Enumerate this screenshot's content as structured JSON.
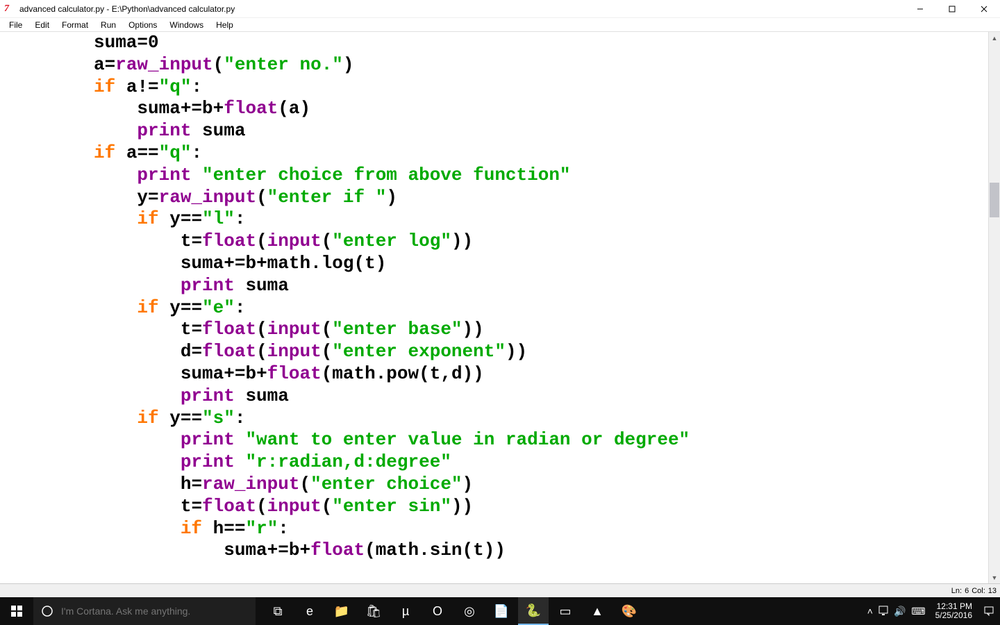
{
  "window": {
    "app_icon_text": "7",
    "title": "advanced calculator.py - E:\\Python\\advanced calculator.py"
  },
  "menubar": {
    "items": [
      "File",
      "Edit",
      "Format",
      "Run",
      "Options",
      "Windows",
      "Help"
    ]
  },
  "code": {
    "tokens": [
      [
        [
          "nm",
          "suma"
        ],
        [
          "op",
          "="
        ],
        [
          "num",
          "0"
        ]
      ],
      [
        [
          "nm",
          "a"
        ],
        [
          "op",
          "="
        ],
        [
          "bi",
          "raw_input"
        ],
        [
          "op",
          "("
        ],
        [
          "str",
          "\"enter no.\""
        ],
        [
          "op",
          ")"
        ]
      ],
      [
        [
          "kw",
          "if"
        ],
        [
          "nm",
          " a"
        ],
        [
          "op",
          "!="
        ],
        [
          "str",
          "\"q\""
        ],
        [
          "op",
          ":"
        ]
      ],
      [
        [
          "nm",
          "    suma"
        ],
        [
          "op",
          "+="
        ],
        [
          "nm",
          "b"
        ],
        [
          "op",
          "+"
        ],
        [
          "bi",
          "float"
        ],
        [
          "op",
          "("
        ],
        [
          "nm",
          "a"
        ],
        [
          "op",
          ")"
        ]
      ],
      [
        [
          "nm",
          "    "
        ],
        [
          "bi",
          "print"
        ],
        [
          "nm",
          " suma"
        ]
      ],
      [
        [
          "kw",
          "if"
        ],
        [
          "nm",
          " a"
        ],
        [
          "op",
          "=="
        ],
        [
          "str",
          "\"q\""
        ],
        [
          "op",
          ":"
        ]
      ],
      [
        [
          "nm",
          "    "
        ],
        [
          "bi",
          "print"
        ],
        [
          "nm",
          " "
        ],
        [
          "str",
          "\"enter choice from above function\""
        ]
      ],
      [
        [
          "nm",
          "    y"
        ],
        [
          "op",
          "="
        ],
        [
          "bi",
          "raw_input"
        ],
        [
          "op",
          "("
        ],
        [
          "str",
          "\"enter if \""
        ],
        [
          "op",
          ")"
        ]
      ],
      [
        [
          "nm",
          "    "
        ],
        [
          "kw",
          "if"
        ],
        [
          "nm",
          " y"
        ],
        [
          "op",
          "=="
        ],
        [
          "str",
          "\"l\""
        ],
        [
          "op",
          ":"
        ]
      ],
      [
        [
          "nm",
          "        t"
        ],
        [
          "op",
          "="
        ],
        [
          "bi",
          "float"
        ],
        [
          "op",
          "("
        ],
        [
          "bi",
          "input"
        ],
        [
          "op",
          "("
        ],
        [
          "str",
          "\"enter log\""
        ],
        [
          "op",
          "))"
        ]
      ],
      [
        [
          "nm",
          "        suma"
        ],
        [
          "op",
          "+="
        ],
        [
          "nm",
          "b"
        ],
        [
          "op",
          "+"
        ],
        [
          "nm",
          "math.log"
        ],
        [
          "op",
          "("
        ],
        [
          "nm",
          "t"
        ],
        [
          "op",
          ")"
        ]
      ],
      [
        [
          "nm",
          "        "
        ],
        [
          "bi",
          "print"
        ],
        [
          "nm",
          " suma"
        ]
      ],
      [
        [
          "nm",
          "    "
        ],
        [
          "kw",
          "if"
        ],
        [
          "nm",
          " y"
        ],
        [
          "op",
          "=="
        ],
        [
          "str",
          "\"e\""
        ],
        [
          "op",
          ":"
        ]
      ],
      [
        [
          "nm",
          "        t"
        ],
        [
          "op",
          "="
        ],
        [
          "bi",
          "float"
        ],
        [
          "op",
          "("
        ],
        [
          "bi",
          "input"
        ],
        [
          "op",
          "("
        ],
        [
          "str",
          "\"enter base\""
        ],
        [
          "op",
          "))"
        ]
      ],
      [
        [
          "nm",
          "        d"
        ],
        [
          "op",
          "="
        ],
        [
          "bi",
          "float"
        ],
        [
          "op",
          "("
        ],
        [
          "bi",
          "input"
        ],
        [
          "op",
          "("
        ],
        [
          "str",
          "\"enter exponent\""
        ],
        [
          "op",
          "))"
        ]
      ],
      [
        [
          "nm",
          "        suma"
        ],
        [
          "op",
          "+="
        ],
        [
          "nm",
          "b"
        ],
        [
          "op",
          "+"
        ],
        [
          "bi",
          "float"
        ],
        [
          "op",
          "("
        ],
        [
          "nm",
          "math.pow"
        ],
        [
          "op",
          "("
        ],
        [
          "nm",
          "t"
        ],
        [
          "op",
          ","
        ],
        [
          "nm",
          "d"
        ],
        [
          "op",
          "))"
        ]
      ],
      [
        [
          "nm",
          "        "
        ],
        [
          "bi",
          "print"
        ],
        [
          "nm",
          " suma"
        ]
      ],
      [
        [
          "nm",
          "    "
        ],
        [
          "kw",
          "if"
        ],
        [
          "nm",
          " y"
        ],
        [
          "op",
          "=="
        ],
        [
          "str",
          "\"s\""
        ],
        [
          "op",
          ":"
        ]
      ],
      [
        [
          "nm",
          "        "
        ],
        [
          "bi",
          "print"
        ],
        [
          "nm",
          " "
        ],
        [
          "str",
          "\"want to enter value in radian or degree\""
        ]
      ],
      [
        [
          "nm",
          "        "
        ],
        [
          "bi",
          "print"
        ],
        [
          "nm",
          " "
        ],
        [
          "str",
          "\"r:radian,d:degree\""
        ]
      ],
      [
        [
          "nm",
          "        h"
        ],
        [
          "op",
          "="
        ],
        [
          "bi",
          "raw_input"
        ],
        [
          "op",
          "("
        ],
        [
          "str",
          "\"enter choice\""
        ],
        [
          "op",
          ")"
        ]
      ],
      [
        [
          "nm",
          "        t"
        ],
        [
          "op",
          "="
        ],
        [
          "bi",
          "float"
        ],
        [
          "op",
          "("
        ],
        [
          "bi",
          "input"
        ],
        [
          "op",
          "("
        ],
        [
          "str",
          "\"enter sin\""
        ],
        [
          "op",
          "))"
        ]
      ],
      [
        [
          "nm",
          "        "
        ],
        [
          "kw",
          "if"
        ],
        [
          "nm",
          " h"
        ],
        [
          "op",
          "=="
        ],
        [
          "str",
          "\"r\""
        ],
        [
          "op",
          ":"
        ]
      ],
      [
        [
          "nm",
          "            suma"
        ],
        [
          "op",
          "+="
        ],
        [
          "nm",
          "b"
        ],
        [
          "op",
          "+"
        ],
        [
          "bi",
          "float"
        ],
        [
          "op",
          "("
        ],
        [
          "nm",
          "math.sin"
        ],
        [
          "op",
          "("
        ],
        [
          "nm",
          "t"
        ],
        [
          "op",
          "))"
        ]
      ]
    ]
  },
  "statusbar": {
    "ln_label": "Ln:",
    "ln_value": "6",
    "col_label": "Col:",
    "col_value": "13"
  },
  "taskbar": {
    "cortana_placeholder": "I'm Cortana. Ask me anything.",
    "clock_time": "12:31 PM",
    "clock_date": "5/25/2016",
    "apps": [
      {
        "name": "task-view",
        "glyph": "⧉"
      },
      {
        "name": "edge",
        "glyph": "e"
      },
      {
        "name": "file-explorer",
        "glyph": "📁"
      },
      {
        "name": "store",
        "glyph": "🛍"
      },
      {
        "name": "utorrent",
        "glyph": "µ"
      },
      {
        "name": "opera",
        "glyph": "O"
      },
      {
        "name": "chrome",
        "glyph": "◎"
      },
      {
        "name": "notepadpp",
        "glyph": "📄"
      },
      {
        "name": "idle",
        "glyph": "🐍",
        "active": true
      },
      {
        "name": "mysql",
        "glyph": "▭"
      },
      {
        "name": "drive",
        "glyph": "▲"
      },
      {
        "name": "paint",
        "glyph": "🎨"
      }
    ]
  }
}
